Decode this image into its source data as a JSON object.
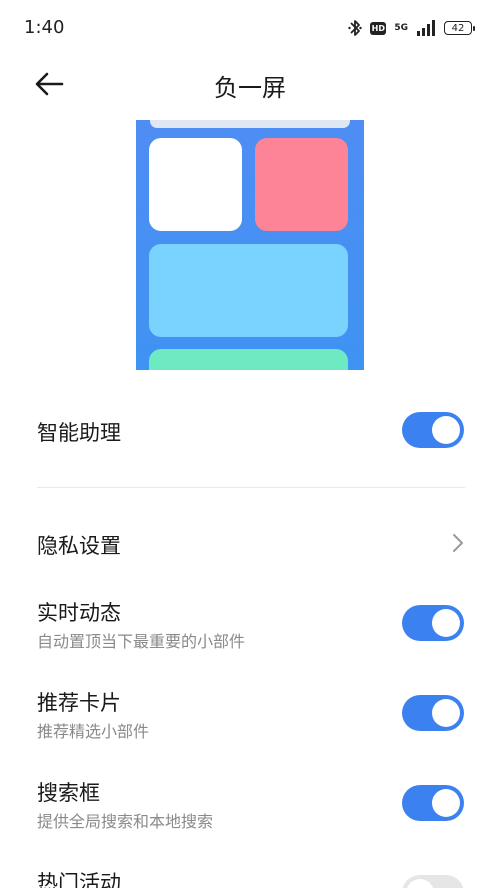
{
  "status_bar": {
    "time": "1:40",
    "net_type": "5G",
    "hd_label": "HD",
    "battery": "42"
  },
  "header": {
    "title": "负一屏",
    "back_icon": "arrow-left-icon"
  },
  "preview": {
    "colors": {
      "background": "#4a8ff3",
      "card_white": "#ffffff",
      "card_red": "#fd8496",
      "card_wide": "#7ad3fe",
      "card_green": "#6eeac3"
    }
  },
  "settings": {
    "smart_assistant": {
      "label": "智能助理",
      "enabled": true
    },
    "privacy": {
      "label": "隐私设置",
      "icon": "chevron-right-icon"
    },
    "live_updates": {
      "label": "实时动态",
      "desc": "自动置顶当下最重要的小部件",
      "enabled": true
    },
    "recommended_cards": {
      "label": "推荐卡片",
      "desc": "推荐精选小部件",
      "enabled": true
    },
    "search_box": {
      "label": "搜索框",
      "desc": "提供全局搜索和本地搜索",
      "enabled": true
    },
    "hot_events": {
      "label": "热门活动",
      "enabled": false
    }
  },
  "colors": {
    "accent": "#3b82f0",
    "toggle_off": "#e6e6e6",
    "secondary_text": "#8a8a8a"
  }
}
